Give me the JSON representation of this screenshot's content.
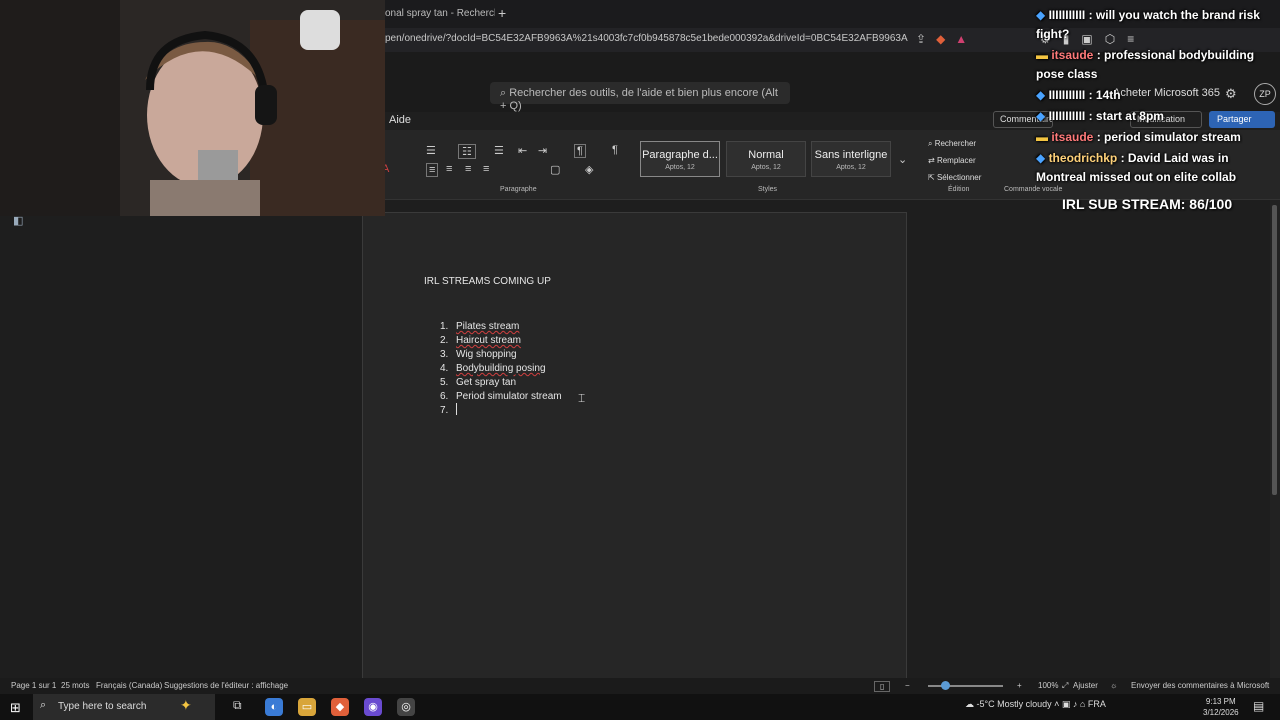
{
  "browser": {
    "tab_title": "onal spray tan - Recherche G",
    "new_tab": "+",
    "url": "pen/onedrive/?docId=BC54E32AFB9963A%21s4003fc7cf0b945878c5e1bede000392a&driveId=0BC54E32AFB9963A"
  },
  "word": {
    "search_placeholder": "Rechercher des outils, de l'aide et bien plus encore (Alt + Q)",
    "buy_365": "Acheter Microsoft 365",
    "avatar": "ZP",
    "menu_aide": "Aide",
    "comments_button": "Commentaires",
    "edit_button": "Modification",
    "share_button": "Partager",
    "groups": {
      "paragraph": "Paragraphe",
      "styles": "Styles",
      "edition": "Édition",
      "voice": "Commande vocale"
    },
    "styles": [
      {
        "name": "Paragraphe d...",
        "font": "Aptos, 12"
      },
      {
        "name": "Normal",
        "font": "Aptos, 12"
      },
      {
        "name": "Sans interligne",
        "font": "Aptos, 12"
      }
    ],
    "edition": {
      "find": "Rechercher",
      "replace": "Remplacer",
      "select": "Sélectionner"
    }
  },
  "document": {
    "title": "IRL STREAMS COMING UP",
    "items": [
      {
        "num": "1.",
        "text": "Pilates stream"
      },
      {
        "num": "2.",
        "text": "Haircut stream"
      },
      {
        "num": "3.",
        "text": "Wig shopping"
      },
      {
        "num": "4.",
        "text": "Bodybuilding posing"
      },
      {
        "num": "5.",
        "text": "Get spray tan"
      },
      {
        "num": "6.",
        "text": "Period simulator stream"
      },
      {
        "num": "7.",
        "text": ""
      }
    ]
  },
  "statusbar": {
    "page": "Page 1 sur 1",
    "words": "25 mots",
    "language": "Français (Canada)",
    "suggestions": "Suggestions de l'éditeur : affichage",
    "zoom": "100%",
    "fit": "Ajuster",
    "feedback": "Envoyer des commentaires à Microsoft"
  },
  "taskbar": {
    "search_placeholder": "Type here to search",
    "weather": "-5°C  Mostly cloudy",
    "lang": "FRA",
    "time": "9:13 PM",
    "date": "3/12/2026"
  },
  "chat": [
    {
      "user": "IIIIIIIIIII",
      "text": "will you watch the brand risk fight?",
      "user_color": "#ffffff"
    },
    {
      "user": "itsaude",
      "text": "professional bodybuilding pose class",
      "user_color": "#ff7a7a"
    },
    {
      "user": "IIIIIIIIIII",
      "text": "14th",
      "user_color": "#ffffff"
    },
    {
      "user": "IIIIIIIIIII",
      "text": "start at 8pm",
      "user_color": "#ffffff"
    },
    {
      "user": "itsaude",
      "text": "period simulator stream",
      "user_color": "#ff7a7a"
    },
    {
      "user": "theodrichkp",
      "text": "David Laid was in Montreal missed out on elite collab",
      "user_color": "#ffffff"
    }
  ],
  "sub_counter": "IRL SUB STREAM: 86/100",
  "colors": {
    "share_button": "#2d64b5",
    "page_bg": "#262626",
    "accent": "#5b9bd5"
  }
}
